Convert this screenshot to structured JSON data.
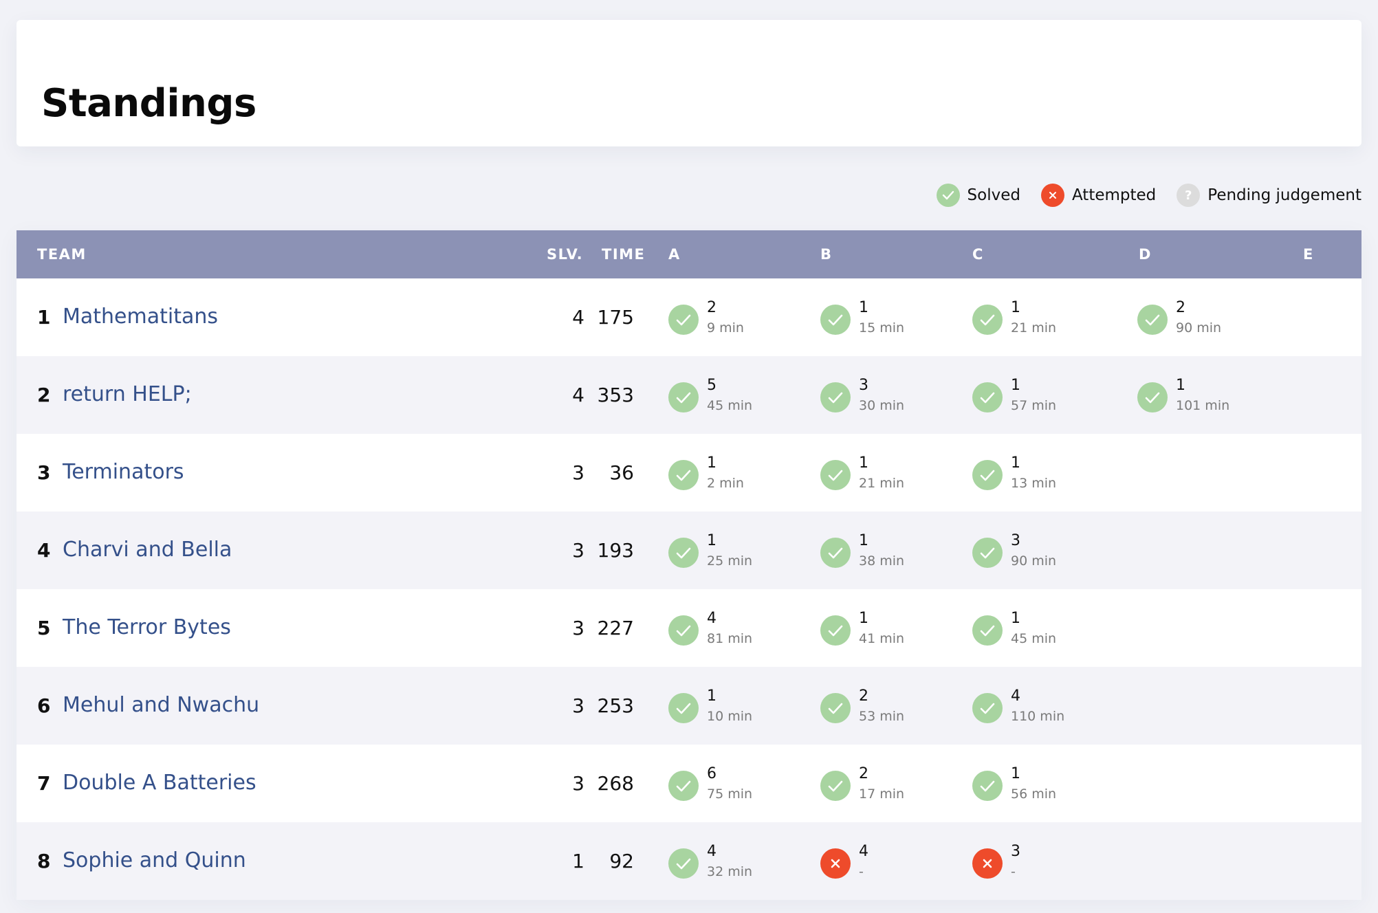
{
  "page": {
    "title": "Standings"
  },
  "legend": [
    {
      "status": "solved",
      "label": "Solved",
      "icon": "check-icon"
    },
    {
      "status": "attempted",
      "label": "Attempted",
      "icon": "cross-icon"
    },
    {
      "status": "pending",
      "label": "Pending judgement",
      "icon": "question-icon"
    }
  ],
  "colors": {
    "solved": "#a8d4a0",
    "attempted": "#ee4b2b",
    "pending": "#dcdcdc",
    "header": "#8c92b5",
    "team_link": "#34508a"
  },
  "table": {
    "headers": {
      "team": "TEAM",
      "slv": "SLV.",
      "time": "TIME",
      "problems": [
        "A",
        "B",
        "C",
        "D",
        "E"
      ]
    },
    "rows": [
      {
        "rank": "1",
        "team": "Mathematitans",
        "slv": "4",
        "time": "175",
        "problems": [
          {
            "status": "solved",
            "tries": "2",
            "time": "9 min"
          },
          {
            "status": "solved",
            "tries": "1",
            "time": "15 min"
          },
          {
            "status": "solved",
            "tries": "1",
            "time": "21 min"
          },
          {
            "status": "solved",
            "tries": "2",
            "time": "90 min"
          },
          null
        ]
      },
      {
        "rank": "2",
        "team": "return HELP;",
        "slv": "4",
        "time": "353",
        "problems": [
          {
            "status": "solved",
            "tries": "5",
            "time": "45 min"
          },
          {
            "status": "solved",
            "tries": "3",
            "time": "30 min"
          },
          {
            "status": "solved",
            "tries": "1",
            "time": "57 min"
          },
          {
            "status": "solved",
            "tries": "1",
            "time": "101 min"
          },
          null
        ]
      },
      {
        "rank": "3",
        "team": "Terminators",
        "slv": "3",
        "time": "36",
        "problems": [
          {
            "status": "solved",
            "tries": "1",
            "time": "2 min"
          },
          {
            "status": "solved",
            "tries": "1",
            "time": "21 min"
          },
          {
            "status": "solved",
            "tries": "1",
            "time": "13 min"
          },
          null,
          null
        ]
      },
      {
        "rank": "4",
        "team": "Charvi and Bella",
        "slv": "3",
        "time": "193",
        "problems": [
          {
            "status": "solved",
            "tries": "1",
            "time": "25 min"
          },
          {
            "status": "solved",
            "tries": "1",
            "time": "38 min"
          },
          {
            "status": "solved",
            "tries": "3",
            "time": "90 min"
          },
          null,
          null
        ]
      },
      {
        "rank": "5",
        "team": "The Terror Bytes",
        "slv": "3",
        "time": "227",
        "problems": [
          {
            "status": "solved",
            "tries": "4",
            "time": "81 min"
          },
          {
            "status": "solved",
            "tries": "1",
            "time": "41 min"
          },
          {
            "status": "solved",
            "tries": "1",
            "time": "45 min"
          },
          null,
          null
        ]
      },
      {
        "rank": "6",
        "team": "Mehul and Nwachu",
        "slv": "3",
        "time": "253",
        "problems": [
          {
            "status": "solved",
            "tries": "1",
            "time": "10 min"
          },
          {
            "status": "solved",
            "tries": "2",
            "time": "53 min"
          },
          {
            "status": "solved",
            "tries": "4",
            "time": "110 min"
          },
          null,
          null
        ]
      },
      {
        "rank": "7",
        "team": "Double A Batteries",
        "slv": "3",
        "time": "268",
        "problems": [
          {
            "status": "solved",
            "tries": "6",
            "time": "75 min"
          },
          {
            "status": "solved",
            "tries": "2",
            "time": "17 min"
          },
          {
            "status": "solved",
            "tries": "1",
            "time": "56 min"
          },
          null,
          null
        ]
      },
      {
        "rank": "8",
        "team": "Sophie and Quinn",
        "slv": "1",
        "time": "92",
        "problems": [
          {
            "status": "solved",
            "tries": "4",
            "time": "32 min"
          },
          {
            "status": "attempted",
            "tries": "4",
            "time": "-"
          },
          {
            "status": "attempted",
            "tries": "3",
            "time": "-"
          },
          null,
          null
        ]
      }
    ]
  }
}
